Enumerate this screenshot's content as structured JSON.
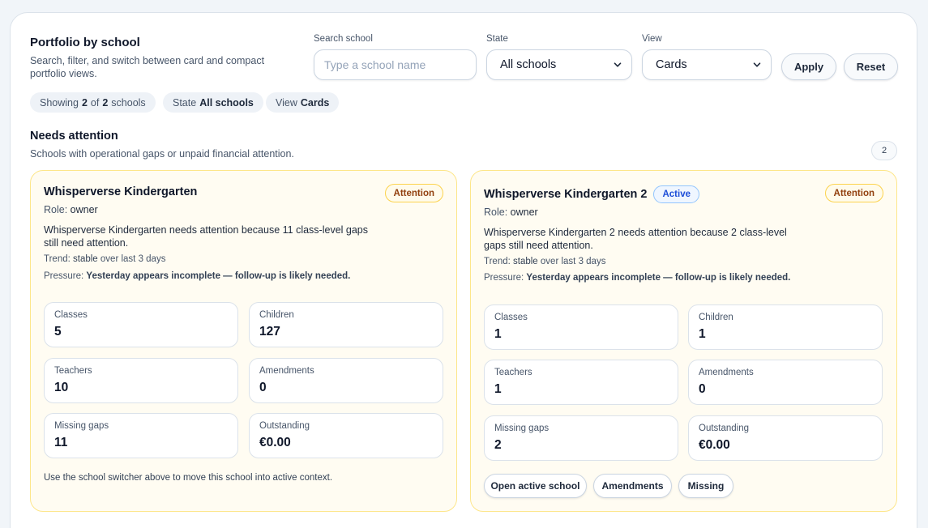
{
  "header": {
    "title": "Portfolio by school",
    "description": "Search, filter, and switch between card and compact portfolio views."
  },
  "filters": {
    "search_label": "Search school",
    "search_placeholder": "Type a school name",
    "search_value": "",
    "state_label": "State",
    "state_value": "All schools",
    "view_label": "View",
    "view_value": "Cards",
    "apply_label": "Apply",
    "reset_label": "Reset"
  },
  "summary_chips": {
    "showing_prefix": "Showing",
    "showing_count": "2",
    "showing_of": "of",
    "showing_total": "2",
    "showing_suffix": "schools",
    "state_prefix": "State",
    "state_value": "All schools",
    "view_prefix": "View",
    "view_value": "Cards"
  },
  "section": {
    "title": "Needs attention",
    "description": "Schools with operational gaps or unpaid financial attention.",
    "count": "2"
  },
  "schools": [
    {
      "name": "Whisperverse Kindergarten",
      "status_badge": "",
      "attention_badge": "Attention",
      "role_label": "Role:",
      "role": "owner",
      "description": "Whisperverse Kindergarten needs attention because 11 class-level gaps still need attention.",
      "trend_label": "Trend:",
      "trend_value": "stable",
      "trend_suffix": "over last 3 days",
      "pressure_label": "Pressure:",
      "pressure_value": "Yesterday appears incomplete — follow-up is likely needed.",
      "stats": [
        {
          "label": "Classes",
          "value": "5"
        },
        {
          "label": "Children",
          "value": "127"
        },
        {
          "label": "Teachers",
          "value": "10"
        },
        {
          "label": "Amendments",
          "value": "0"
        },
        {
          "label": "Missing gaps",
          "value": "11"
        },
        {
          "label": "Outstanding",
          "value": "€0.00"
        }
      ],
      "footnote": "Use the school switcher above to move this school into active context."
    },
    {
      "name": "Whisperverse Kindergarten 2",
      "status_badge": "Active",
      "attention_badge": "Attention",
      "role_label": "Role:",
      "role": "owner",
      "description": "Whisperverse Kindergarten 2 needs attention because 2 class-level gaps still need attention.",
      "trend_label": "Trend:",
      "trend_value": "stable",
      "trend_suffix": "over last 3 days",
      "pressure_label": "Pressure:",
      "pressure_value": "Yesterday appears incomplete — follow-up is likely needed.",
      "stats": [
        {
          "label": "Classes",
          "value": "1"
        },
        {
          "label": "Children",
          "value": "1"
        },
        {
          "label": "Teachers",
          "value": "1"
        },
        {
          "label": "Amendments",
          "value": "0"
        },
        {
          "label": "Missing gaps",
          "value": "2"
        },
        {
          "label": "Outstanding",
          "value": "€0.00"
        }
      ],
      "actions": [
        "Open active school",
        "Amendments",
        "Missing"
      ]
    }
  ],
  "colors": {
    "page_bg": "#f1f5f9",
    "card_bg": "#fffcf2",
    "card_border": "#fde68a",
    "attention": "#92400e",
    "active": "#1d4ed8"
  }
}
